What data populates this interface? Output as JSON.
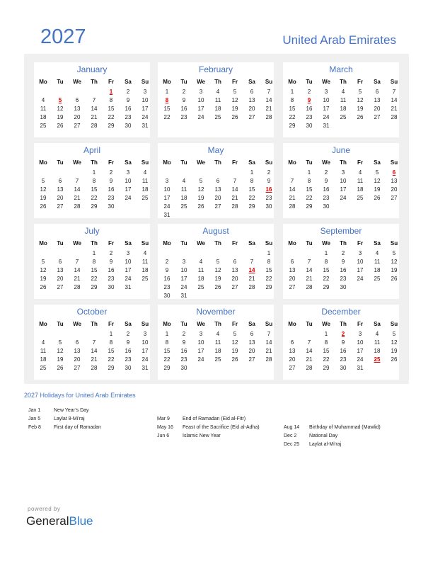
{
  "header": {
    "year": "2027",
    "country": "United Arab Emirates"
  },
  "weekdays": [
    "Mo",
    "Tu",
    "We",
    "Th",
    "Fr",
    "Sa",
    "Su"
  ],
  "months": [
    {
      "name": "January",
      "offset": 4,
      "days": 31,
      "holidays": [
        1,
        5
      ]
    },
    {
      "name": "February",
      "offset": 0,
      "days": 28,
      "holidays": [
        8
      ]
    },
    {
      "name": "March",
      "offset": 0,
      "days": 31,
      "holidays": [
        9
      ]
    },
    {
      "name": "April",
      "offset": 3,
      "days": 30,
      "holidays": []
    },
    {
      "name": "May",
      "offset": 5,
      "days": 31,
      "holidays": [
        16
      ]
    },
    {
      "name": "June",
      "offset": 1,
      "days": 30,
      "holidays": [
        6
      ]
    },
    {
      "name": "July",
      "offset": 3,
      "days": 31,
      "holidays": []
    },
    {
      "name": "August",
      "offset": 6,
      "days": 31,
      "holidays": [
        14
      ]
    },
    {
      "name": "September",
      "offset": 2,
      "days": 30,
      "holidays": []
    },
    {
      "name": "October",
      "offset": 4,
      "days": 31,
      "holidays": []
    },
    {
      "name": "November",
      "offset": 0,
      "days": 30,
      "holidays": []
    },
    {
      "name": "December",
      "offset": 2,
      "days": 31,
      "holidays": [
        2,
        25
      ]
    }
  ],
  "holidays_section": {
    "title": "2027 Holidays for United Arab Emirates",
    "columns": [
      [
        {
          "date": "Jan 1",
          "name": "New Year’s Day"
        },
        {
          "date": "Jan 5",
          "name": "Laylat 8-Mi’raj"
        },
        {
          "date": "Feb 8",
          "name": "First day of Ramadan"
        }
      ],
      [
        {
          "date": "Mar 9",
          "name": "End of Ramadan (Eid al-Fitr)"
        },
        {
          "date": "May 16",
          "name": "Feast of the Sacrifice (Eid al-Adha)"
        },
        {
          "date": "Jun 6",
          "name": "Islamic New Year"
        }
      ],
      [
        {
          "date": "Aug 14",
          "name": "Birthday of Muhammad (Mawlid)"
        },
        {
          "date": "Dec 2",
          "name": "National Day"
        },
        {
          "date": "Dec 25",
          "name": "Laylat al-Mi’raj"
        }
      ]
    ]
  },
  "footer": {
    "powered_by": "powered by",
    "brand_general": "General",
    "brand_blue": "Blue"
  },
  "colors": {
    "accent": "#4472c4",
    "holiday": "#e00000",
    "panel": "#f0f0f0",
    "brand_blue": "#2f7fd1"
  }
}
